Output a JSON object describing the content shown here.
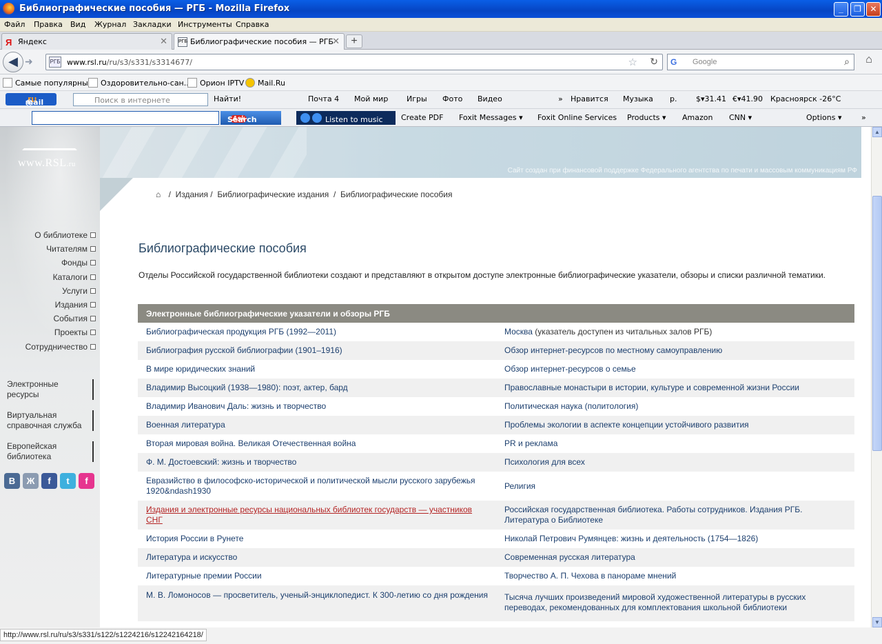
{
  "window": {
    "title": "Библиографические пособия — РГБ - Mozilla Firefox",
    "minimize": "_",
    "maximize": "❐",
    "close": "✕"
  },
  "menu": [
    "Файл",
    "Правка",
    "Вид",
    "Журнал",
    "Закладки",
    "Инструменты",
    "Справка"
  ],
  "tabs": [
    {
      "label": "Яндекс",
      "close": "✕"
    },
    {
      "label": "Библиографические пособия — РГБ",
      "close": "✕"
    }
  ],
  "new_tab": "+",
  "nav": {
    "back": "◀",
    "forward": "➜",
    "site_icon": "РГБ",
    "url_domain": "www.rsl.ru",
    "url_path": "/ru/s3/s331/s3314677/",
    "star": "☆",
    "reload": "↻",
    "search_engine_icon": "G",
    "search_placeholder": "Google",
    "search_icon": "⌕",
    "home_icon": "⌂"
  },
  "bookmarks": [
    "Самые популярные",
    "Оздоровительно-сан...",
    "Орион IPTV",
    "Mail.Ru"
  ],
  "mailru_toolbar": {
    "logo_at": "@",
    "logo_mail": "mail",
    "logo_ru": ".ru",
    "search_placeholder": "Поиск в интернете",
    "find": "Найти!",
    "items": [
      "Почта 4",
      "Мой мир",
      "Игры",
      "Фото",
      "Видео",
      "»",
      "Нравится",
      "Музыка",
      "р.",
      "$▾31.41",
      "€▾41.90",
      "Красноярск -26°C"
    ]
  },
  "ask_toolbar": {
    "search_button": "Search",
    "ask_badge": "Ask",
    "music": "Listen to music",
    "items": [
      "Create PDF",
      "Foxit Messages ▾",
      "Foxit Online Services",
      "Products ▾",
      "Amazon",
      "CNN ▾",
      "Options ▾",
      "»"
    ]
  },
  "site": {
    "logo": "www.RSL",
    "logo_suffix": ".ru",
    "sponsor": "Сайт создан при финансовой поддержке Федерального агентства по печати и массовым коммуникациям РФ",
    "breadcrumb": [
      "Издания /",
      "Библиографические издания",
      "/",
      "Библиографические пособия"
    ],
    "breadcrumb_sep": "/",
    "home_icon": "⌂",
    "nav": [
      "О библиотеке",
      "Читателям",
      "Фонды",
      "Каталоги",
      "Услуги",
      "Издания",
      "События",
      "Проекты",
      "Сотрудничество"
    ],
    "side_links": [
      "Электронные ресурсы",
      "Виртуальная справочная служба",
      "Европейская библиотека"
    ],
    "social": [
      "В",
      "Ж",
      "f",
      "t",
      "f"
    ],
    "title": "Библиографические пособия",
    "intro": "Отделы Российской государственной библиотеки создают и представляют в открытом доступе электронные библиографические указатели, обзоры и списки различной тематики.",
    "table_heading": "Электронные библиографические указатели и обзоры РГБ",
    "rows": [
      {
        "left": "Библиографическая продукция РГБ (1992—2011)",
        "right": "Москва",
        "right_note": " (указатель доступен из читальных залов РГБ)"
      },
      {
        "left": "Библиография русской библиографии (1901–1916)",
        "right": "Обзор интернет-ресурсов по местному самоуправлению"
      },
      {
        "left": "В мире юридических знаний",
        "right": "Обзор интернет-ресурсов о семье"
      },
      {
        "left": "Владимир Высоцкий (1938—1980): поэт, актер, бард",
        "right": "Православные монастыри в истории, культуре и современной жизни России"
      },
      {
        "left": "Владимир Иванович Даль: жизнь и творчество",
        "right": "Политическая наука (политология)"
      },
      {
        "left": "Военная литература",
        "right": "Проблемы экологии в аспекте концепции устойчивого развития"
      },
      {
        "left": "Вторая мировая война. Великая Отечественная война",
        "right": "PR и реклама"
      },
      {
        "left": "Ф. М. Достоевский: жизнь и творчество",
        "right": "Психология для всех"
      },
      {
        "left": "Евразийство в философско-исторической и политической мысли русского зарубежья 1920&ndash1930",
        "right": "Религия"
      },
      {
        "left": "Издания и электронные ресурсы национальных библиотек государств — участников СНГ",
        "right": "Российская государственная библиотека. Работы сотрудников. Издания РГБ. Литература о Библиотеке"
      },
      {
        "left": "История России в Рунете",
        "right": "Николай Петрович Румянцев: жизнь и деятельность (1754—1826)"
      },
      {
        "left": "Литература и искусство",
        "right": "Современная русская литература"
      },
      {
        "left": "Литературные премии России",
        "right": "Творчество А. П. Чехова в панораме мнений"
      },
      {
        "left": "М. В. Ломоносов — просветитель, ученый-энциклопедист. К 300-летию со дня рождения",
        "right": " Тысяча лучших произведений мировой художественной литературы в русских переводах, рекомендованных для комплектования школьной библиотеки"
      }
    ]
  },
  "status_url": "http://www.rsl.ru/ru/s3/s331/s122/s1224216/s12242164218/",
  "colors": {
    "link": "#1c3f6e",
    "visited_hover": "#b42424",
    "table_head": "#8b8a82",
    "title": "#2c4a67"
  }
}
